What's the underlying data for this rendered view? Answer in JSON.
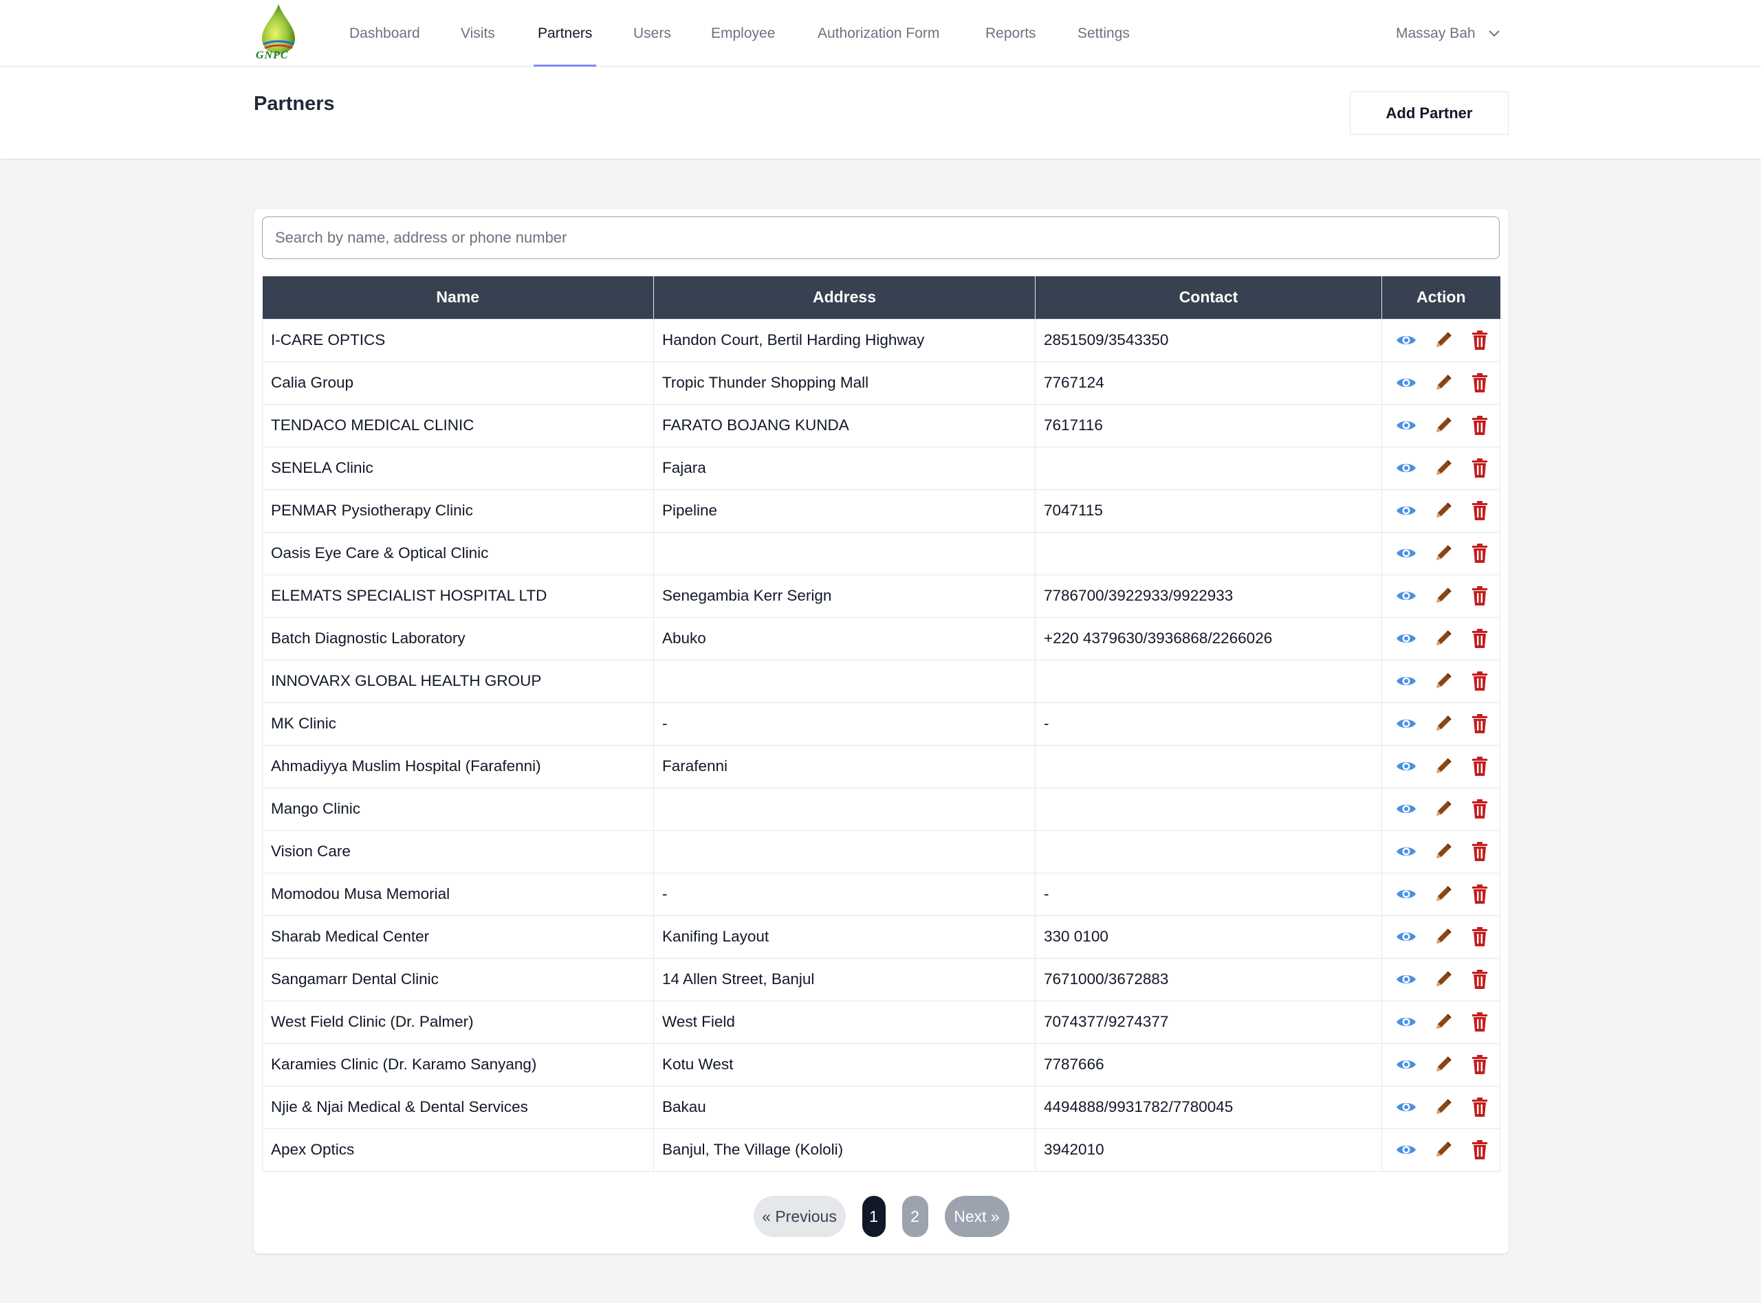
{
  "nav": {
    "logo_text": "GNPC",
    "items": [
      {
        "label": "Dashboard"
      },
      {
        "label": "Visits"
      },
      {
        "label": "Partners"
      },
      {
        "label": "Users"
      },
      {
        "label": "Employee"
      },
      {
        "label": "Authorization Form"
      },
      {
        "label": "Reports"
      },
      {
        "label": "Settings"
      }
    ],
    "active": "Partners",
    "user_name": "Massay Bah"
  },
  "header": {
    "title": "Partners",
    "add_button": "Add Partner"
  },
  "search": {
    "placeholder": "Search by name, address or phone number",
    "value": ""
  },
  "table": {
    "columns": [
      "Name",
      "Address",
      "Contact",
      "Action"
    ],
    "rows": [
      {
        "name": "I-CARE OPTICS",
        "address": "Handon Court, Bertil Harding Highway",
        "contact": "2851509/3543350"
      },
      {
        "name": "Calia Group",
        "address": "Tropic Thunder Shopping Mall",
        "contact": "7767124"
      },
      {
        "name": "TENDACO MEDICAL CLINIC",
        "address": "FARATO BOJANG KUNDA",
        "contact": "7617116"
      },
      {
        "name": "SENELA Clinic",
        "address": "Fajara",
        "contact": ""
      },
      {
        "name": "PENMAR Pysiotherapy Clinic",
        "address": "Pipeline",
        "contact": "7047115"
      },
      {
        "name": "Oasis Eye Care & Optical Clinic",
        "address": "",
        "contact": ""
      },
      {
        "name": "ELEMATS SPECIALIST HOSPITAL LTD",
        "address": "Senegambia Kerr Serign",
        "contact": "7786700/3922933/9922933"
      },
      {
        "name": "Batch Diagnostic Laboratory",
        "address": "Abuko",
        "contact": "+220 4379630/3936868/2266026"
      },
      {
        "name": "INNOVARX GLOBAL HEALTH GROUP",
        "address": "",
        "contact": ""
      },
      {
        "name": "MK Clinic",
        "address": "-",
        "contact": "-"
      },
      {
        "name": "Ahmadiyya Muslim Hospital (Farafenni)",
        "address": "Farafenni",
        "contact": ""
      },
      {
        "name": "Mango Clinic",
        "address": "",
        "contact": ""
      },
      {
        "name": "Vision Care",
        "address": "",
        "contact": ""
      },
      {
        "name": "Momodou Musa Memorial",
        "address": "-",
        "contact": "-"
      },
      {
        "name": "Sharab Medical Center",
        "address": "Kanifing Layout",
        "contact": "330 0100"
      },
      {
        "name": "Sangamarr Dental Clinic",
        "address": "14 Allen Street, Banjul",
        "contact": "7671000/3672883"
      },
      {
        "name": "West Field Clinic (Dr. Palmer)",
        "address": "West Field",
        "contact": "7074377/9274377"
      },
      {
        "name": "Karamies Clinic (Dr. Karamo Sanyang)",
        "address": "Kotu West",
        "contact": "7787666"
      },
      {
        "name": "Njie & Njai Medical & Dental Services",
        "address": "Bakau",
        "contact": "4494888/9931782/7780045"
      },
      {
        "name": "Apex Optics",
        "address": "Banjul, The Village (Kololi)",
        "contact": "3942010"
      }
    ],
    "action_icons": [
      "view-icon",
      "edit-icon",
      "delete-icon"
    ]
  },
  "pagination": {
    "prev": "« Previous",
    "pages": [
      "1",
      "2"
    ],
    "current": "1",
    "next": "Next »"
  },
  "colors": {
    "view": "#4a90e2",
    "edit": "#8b4513",
    "delete": "#c41e1e",
    "table_header": "#374151",
    "active_tab_underline": "#818cf8"
  }
}
